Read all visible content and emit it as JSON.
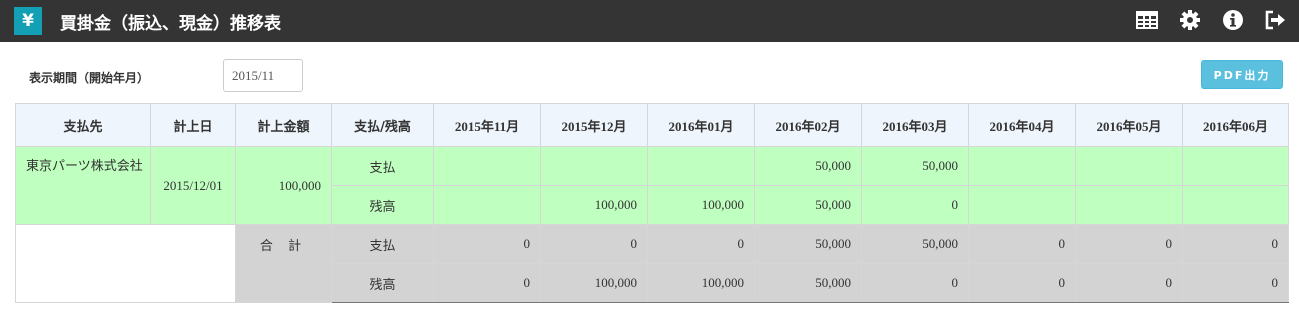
{
  "header": {
    "logo": "¥",
    "title": "買掛金（振込、現金）推移表",
    "icons": [
      "table-icon",
      "gear-icon",
      "info-icon",
      "logout-icon"
    ]
  },
  "filter": {
    "label": "表示期間（開始年月）",
    "value": "2015/11",
    "pdf_label": "PDF出力"
  },
  "table": {
    "columns": [
      "支払先",
      "計上日",
      "計上金額",
      "支払/残高",
      "2015年11月",
      "2015年12月",
      "2016年01月",
      "2016年02月",
      "2016年03月",
      "2016年04月",
      "2016年05月",
      "2016年06月"
    ],
    "rows": [
      {
        "vendor": "東京パーツ株式会社",
        "date": "2015/12/01",
        "amount": "100,000",
        "payment": {
          "label": "支払",
          "values": [
            "",
            "",
            "",
            "50,000",
            "50,000",
            "",
            "",
            ""
          ]
        },
        "balance": {
          "label": "残高",
          "values": [
            "",
            "100,000",
            "100,000",
            "50,000",
            "0",
            "",
            "",
            ""
          ]
        }
      }
    ],
    "total": {
      "label": "合 計",
      "payment": {
        "label": "支払",
        "values": [
          "0",
          "0",
          "0",
          "50,000",
          "50,000",
          "0",
          "0",
          "0"
        ]
      },
      "balance": {
        "label": "残高",
        "values": [
          "0",
          "100,000",
          "100,000",
          "50,000",
          "0",
          "0",
          "0",
          "0"
        ]
      }
    }
  },
  "colors": {
    "header_bg": "#343434",
    "logo_bg": "#14a0b4",
    "row_green": "#bfffbf",
    "total_gray": "#d3d3d3",
    "pdf_button": "#5bc0de"
  }
}
